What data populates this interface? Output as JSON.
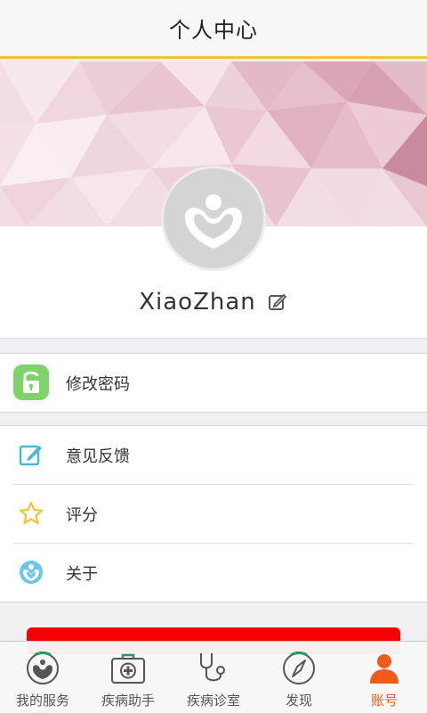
{
  "header": {
    "title": "个人中心"
  },
  "profile": {
    "username": "XiaoZhan"
  },
  "menu_group_1": [
    {
      "label": "修改密码",
      "icon": "lock-icon"
    }
  ],
  "menu_group_2": [
    {
      "label": "意见反馈",
      "icon": "edit-icon"
    },
    {
      "label": "评分",
      "icon": "star-icon"
    },
    {
      "label": "关于",
      "icon": "info-logo-icon"
    }
  ],
  "tabbar": {
    "items": [
      {
        "label": "我的服务",
        "icon": "service-icon",
        "active": false
      },
      {
        "label": "疾病助手",
        "icon": "medkit-icon",
        "active": false
      },
      {
        "label": "疾病诊室",
        "icon": "stethoscope-icon",
        "active": false
      },
      {
        "label": "发现",
        "icon": "compass-icon",
        "active": false
      },
      {
        "label": "账号",
        "icon": "account-icon",
        "active": true
      }
    ]
  },
  "colors": {
    "accent": "#f0c23c",
    "active_tab": "#f25a1e",
    "lock_green": "#7ed36a",
    "logout_red": "#f40000"
  }
}
